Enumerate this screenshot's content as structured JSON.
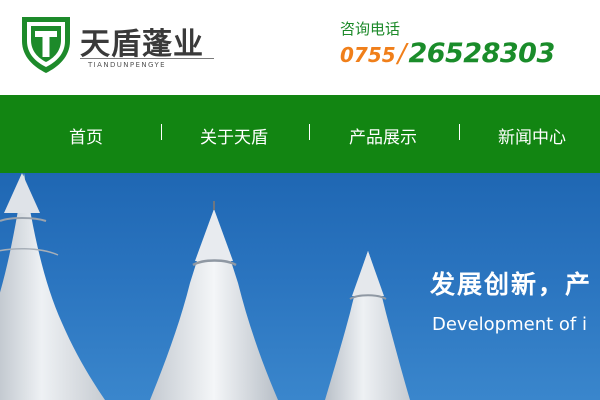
{
  "brand": {
    "name": "天盾蓬业",
    "pinyin": "TIANDUNPENGYE",
    "logo_letter": "T",
    "primary_color": "#128512"
  },
  "contact": {
    "label": "咨询电话",
    "area_code": "0755",
    "separator": "/",
    "number": "26528303",
    "area_color": "#f07f1a",
    "number_color": "#1a8c2a"
  },
  "nav": {
    "items": [
      {
        "label": "首页"
      },
      {
        "label": "关于天盾"
      },
      {
        "label": "产品展示"
      },
      {
        "label": "新闻中心"
      }
    ],
    "separator": "|"
  },
  "banner": {
    "slogan": "发展创新，产",
    "slogan_en": "Development of i",
    "sky_color": "#2a74bf"
  }
}
